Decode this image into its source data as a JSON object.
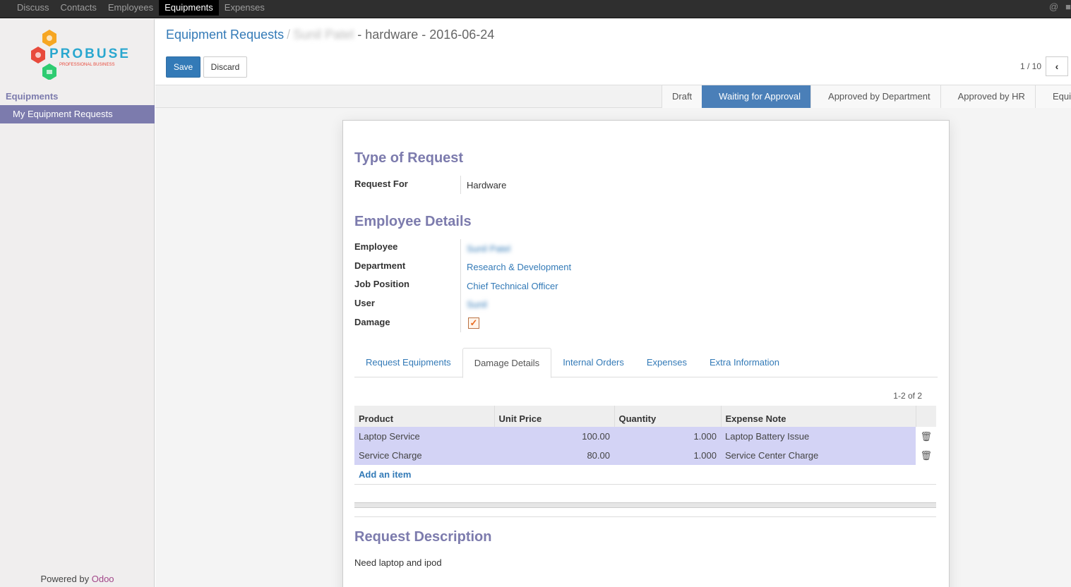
{
  "topnav": {
    "items": [
      "Discuss",
      "Contacts",
      "Employees",
      "Equipments",
      "Expenses"
    ],
    "active": "Equipments"
  },
  "sidebar": {
    "logo_text": "PROBUSE",
    "logo_subtext": "PROFESSIONAL BUSINESS",
    "section": "Equipments",
    "items": [
      {
        "label": "My Equipment Requests"
      }
    ],
    "powered_prefix": "Powered by",
    "powered_brand": "Odoo"
  },
  "header": {
    "breadcrumb_root": "Equipment Requests",
    "breadcrumb_sep": "/",
    "record_name_blurred": "Sunil Patel",
    "record_suffix": "- hardware - 2016-06-24",
    "save_label": "Save",
    "discard_label": "Discard",
    "pager": "1 / 10"
  },
  "stages": [
    "Draft",
    "Waiting for Approval",
    "Approved by Department",
    "Approved by HR",
    "Equipm"
  ],
  "active_stage": "Waiting for Approval",
  "form": {
    "section_request": "Type of Request",
    "request_for_label": "Request For",
    "request_for_value": "Hardware",
    "section_employee": "Employee Details",
    "employee_label": "Employee",
    "employee_value": "Sunil Patel",
    "department_label": "Department",
    "department_value": "Research & Development",
    "job_label": "Job Position",
    "job_value": "Chief Technical Officer",
    "user_label": "User",
    "user_value": "Sunil",
    "damage_label": "Damage",
    "damage_checked": true
  },
  "tabs": [
    "Request Equipments",
    "Damage Details",
    "Internal Orders",
    "Expenses",
    "Extra Information"
  ],
  "active_tab": "Damage Details",
  "table": {
    "count": "1-2 of 2",
    "columns": [
      "Product",
      "Unit Price",
      "Quantity",
      "Expense Note"
    ],
    "rows": [
      {
        "product": "Laptop Service",
        "unit_price": "100.00",
        "quantity": "1.000",
        "note": "Laptop Battery Issue"
      },
      {
        "product": "Service Charge",
        "unit_price": "80.00",
        "quantity": "1.000",
        "note": "Service Center Charge"
      }
    ],
    "add_item": "Add an item"
  },
  "description": {
    "title": "Request Description",
    "text": "Need laptop and ipod"
  },
  "colors": {
    "accent": "#7c7bad",
    "primary": "#337ab7",
    "active_stage": "#4a7fb8",
    "row_highlight": "#d3d3f5"
  }
}
